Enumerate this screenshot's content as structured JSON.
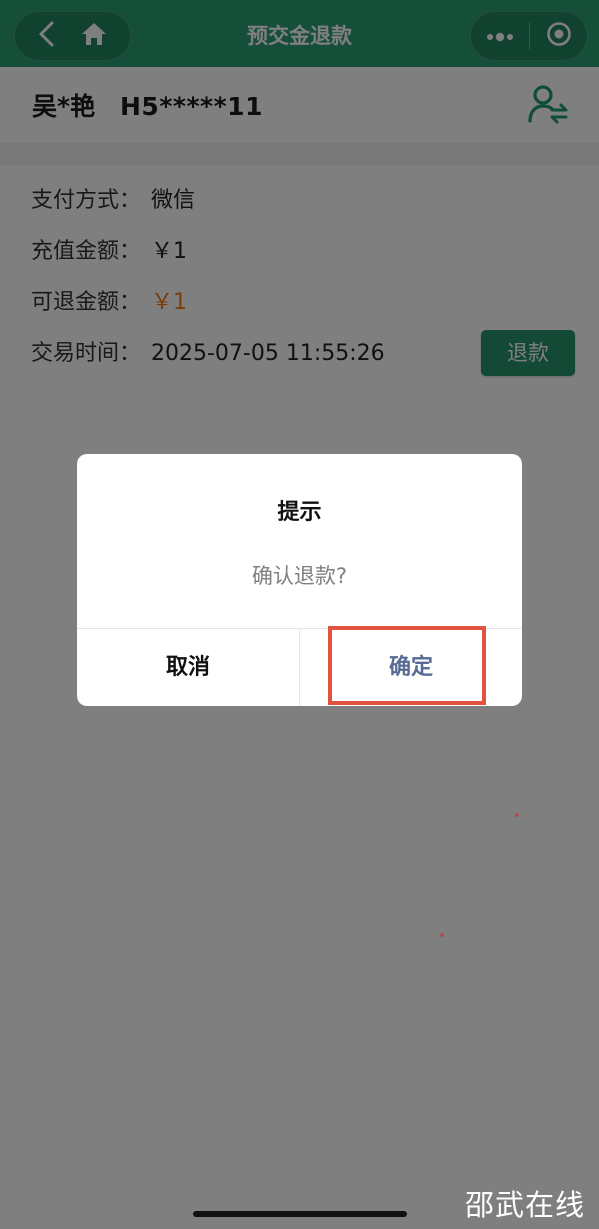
{
  "nav": {
    "title": "预交金退款",
    "background": "#2a9d72",
    "left_icons": [
      "back-icon",
      "home-icon"
    ],
    "right_icons": [
      "more-icon",
      "close-target-icon"
    ]
  },
  "user": {
    "name": "吴*艳",
    "id": "H5*****11",
    "switch_icon": "switch-user-icon"
  },
  "record": {
    "rows": [
      {
        "label": "支付方式：",
        "value": "微信"
      },
      {
        "label": "充值金额：",
        "value": "￥1"
      },
      {
        "label": "可退金额：",
        "value": "￥1"
      },
      {
        "label": "交易时间：",
        "value": "2025-07-05 11:55:26"
      }
    ],
    "refund_button": "退款",
    "refundable_color": "#f27a12"
  },
  "dialog": {
    "title": "提示",
    "message": "确认退款?",
    "cancel": "取消",
    "confirm": "确定",
    "confirm_color": "#576b95",
    "highlight_color": "#e0533f"
  },
  "watermark": "邵武在线"
}
